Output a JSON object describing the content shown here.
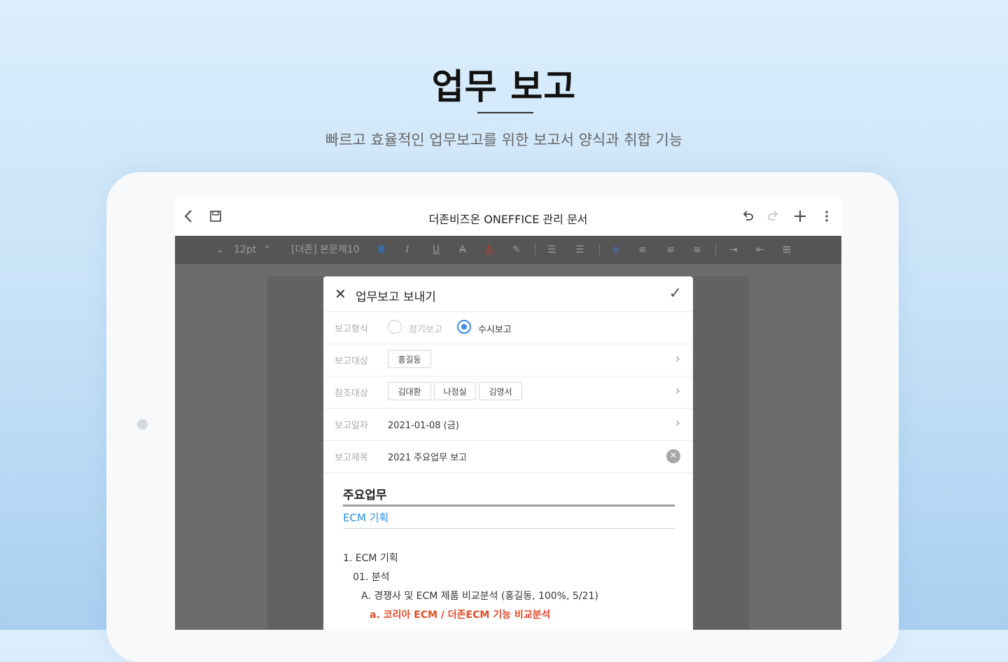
{
  "hero": {
    "title": "업무 보고",
    "subtitle": "빠르고 효율적인 업무보고를 위한 보고서 양식과 취합 기능"
  },
  "appbar": {
    "doc_title": "더존비즈온 ONEFFICE 관리 문서",
    "icons": [
      "back-icon",
      "save-icon",
      "undo-icon",
      "redo-icon",
      "plus-icon",
      "more-icon"
    ]
  },
  "toolbar": {
    "font_size": "12pt",
    "font_name": "[더존] 본문체10",
    "bold": "B",
    "italic": "I",
    "underline": "U",
    "strike": "A",
    "font_color": "A"
  },
  "dialog": {
    "title": "업무보고 보내기",
    "rows": {
      "report_type": {
        "label": "보고형식",
        "option1": "정기보고",
        "option2": "수시보고",
        "selected": "수시보고"
      },
      "report_target": {
        "label": "보고대상",
        "chips": [
          "홍길동"
        ]
      },
      "ref_target": {
        "label": "참조대상",
        "chips": [
          "김대환",
          "나정실",
          "김영서"
        ]
      },
      "report_date": {
        "label": "보고일자",
        "value": "2021-01-08 (금)"
      },
      "report_title": {
        "label": "보고제목",
        "value": "2021 주요업무 보고"
      }
    },
    "body": {
      "section_title": "주요업무",
      "section_link": "ECM 기획",
      "lines": [
        "1. ECM 기획",
        "01. 분석",
        "A. 경쟁사 및 ECM 제품 비교분석 (홍길동, 100%, 5/21)",
        "a. 코리아 ECM / 더존ECM 기능 비교분석"
      ]
    }
  },
  "colors": {
    "accent": "#3d8be6",
    "link": "#2a8ce0",
    "highlight": "#e24a2a"
  }
}
